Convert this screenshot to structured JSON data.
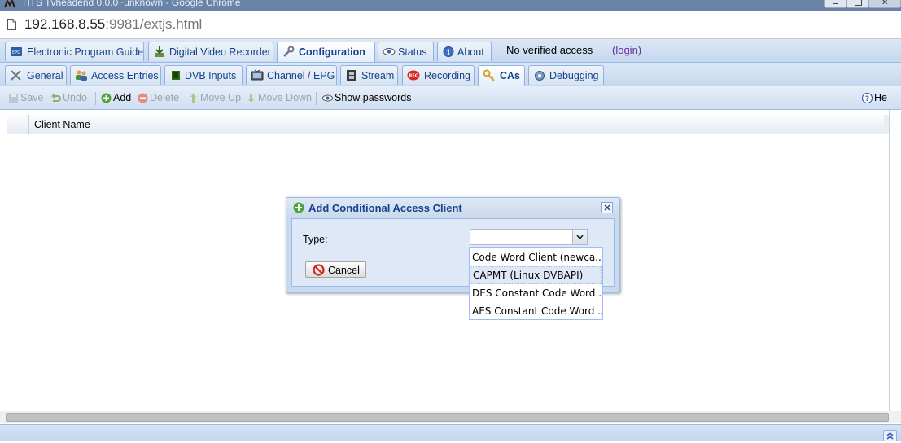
{
  "window": {
    "title": "HTS Tvheadend 0.0.0~unknown - Google Chrome"
  },
  "address": {
    "host": "192.168.8.55",
    "rest": ":9981/extjs.html"
  },
  "main_tabs": [
    {
      "label": "Electronic Program Guide"
    },
    {
      "label": "Digital Video Recorder"
    },
    {
      "label": "Configuration"
    },
    {
      "label": "Status"
    },
    {
      "label": "About"
    }
  ],
  "access": {
    "status": "No verified access",
    "login": "(login)"
  },
  "config_tabs": [
    {
      "label": "General"
    },
    {
      "label": "Access Entries"
    },
    {
      "label": "DVB Inputs"
    },
    {
      "label": "Channel / EPG"
    },
    {
      "label": "Stream"
    },
    {
      "label": "Recording"
    },
    {
      "label": "CAs"
    },
    {
      "label": "Debugging"
    }
  ],
  "toolbar": {
    "save": "Save",
    "undo": "Undo",
    "add": "Add",
    "delete": "Delete",
    "move_up": "Move Up",
    "move_down": "Move Down",
    "show_passwords": "Show passwords",
    "help": "He"
  },
  "grid": {
    "column": "Client Name"
  },
  "dialog": {
    "title": "Add Conditional Access Client",
    "type_label": "Type:",
    "type_value": "",
    "cancel": "Cancel"
  },
  "dropdown": {
    "options": [
      "Code Word Client (newca...",
      "CAPMT (Linux DVBAPI)",
      "DES Constant Code Word ...",
      "AES Constant Code Word ..."
    ],
    "highlighted_index": 1
  },
  "colors": {
    "accent": "#15428b",
    "strip": "#c6d8ef",
    "border": "#99bbe8"
  }
}
